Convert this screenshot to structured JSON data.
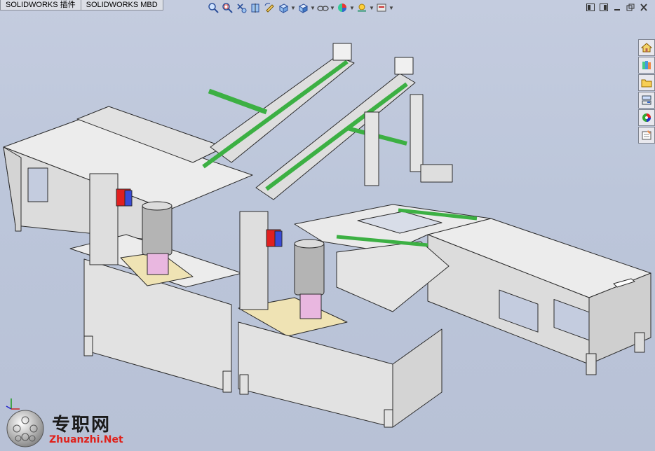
{
  "tabs": [
    {
      "label": "SOLIDWORKS 插件"
    },
    {
      "label": "SOLIDWORKS MBD"
    }
  ],
  "toolbar": {
    "icons": [
      "zoom-to-fit-icon",
      "zoom-to-area-icon",
      "previous-view-icon",
      "section-view-icon",
      "dynamic-annotation-icon",
      "view-orientation-icon",
      "display-style-icon",
      "hide-show-items-icon",
      "edit-appearance-icon",
      "apply-scene-icon",
      "view-settings-icon"
    ]
  },
  "window_controls": [
    "tile-left-icon",
    "tile-right-icon",
    "minimize-icon",
    "restore-icon",
    "close-icon"
  ],
  "task_pane": [
    "home-icon",
    "design-library-icon",
    "file-explorer-icon",
    "view-palette-icon",
    "appearances-icon",
    "custom-properties-icon"
  ],
  "watermark": {
    "brand_cn": "专职网",
    "brand_en": "Zhuanzhi.Net"
  },
  "colors": {
    "frame": "#e6e6e6",
    "frame_edge": "#2a2a2a",
    "rail_green": "#3cb043",
    "plate_yellow": "#efe3b4",
    "motor_pink": "#e9b7e0",
    "motor_gray": "#b4b4b4",
    "red_block": "#e02020",
    "bg": "#bcc6da"
  }
}
